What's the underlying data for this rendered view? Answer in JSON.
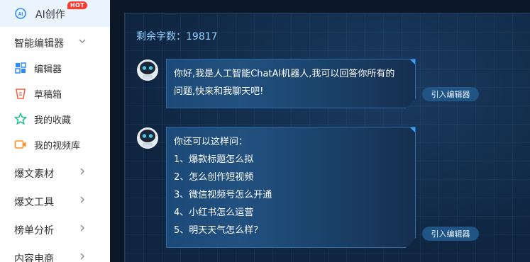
{
  "sidebar": {
    "active_item": {
      "label": "AI创作",
      "badge": "HOT",
      "icon": "ai-create-icon"
    },
    "top_group": {
      "label": "智能编辑器"
    },
    "sub_items": [
      {
        "label": "编辑器",
        "icon": "grid-icon"
      },
      {
        "label": "草稿箱",
        "icon": "draft-icon"
      },
      {
        "label": "我的收藏",
        "icon": "star-icon"
      },
      {
        "label": "我的视频库",
        "icon": "video-icon"
      }
    ],
    "groups": [
      {
        "label": "爆文素材"
      },
      {
        "label": "爆文工具"
      },
      {
        "label": "榜单分析"
      },
      {
        "label": "内容电商"
      }
    ]
  },
  "main": {
    "quota_label": "剩余字数：",
    "quota_value": "19817",
    "messages": [
      {
        "lines": [
          "你好,我是人工智能ChatAI机器人,我可以回答你所有的",
          "问题,快来和我聊天吧!"
        ],
        "insert_label": "引入编辑器"
      },
      {
        "lines": [
          "你还可以这样问：",
          "1、爆款标题怎么拟",
          "2、怎么创作短视频",
          "3、微信视频号怎么开通",
          "4、小红书怎么运营",
          "5、明天天气怎么样？"
        ],
        "insert_label": "引入编辑器"
      }
    ]
  },
  "colors": {
    "accent": "#3aa3ff",
    "quota_text": "#8fd0ff",
    "hot_badge": "#ff3b2f",
    "sidebar_active_bg": "#e9f4ff"
  }
}
